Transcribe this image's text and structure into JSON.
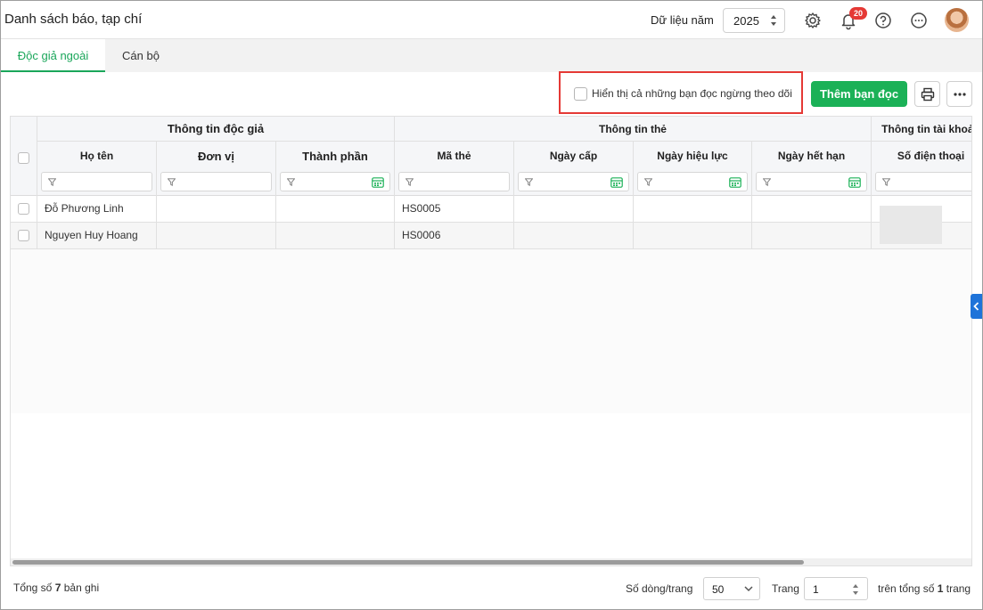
{
  "header": {
    "title": "Danh sách báo, tạp chí",
    "year_label": "Dữ liệu năm",
    "year_value": "2025",
    "notification_count": "20",
    "icons": [
      "gear-icon",
      "bell-icon",
      "help-icon",
      "more-icon"
    ]
  },
  "tabs": [
    {
      "label": "Độc giả ngoài",
      "active": true
    },
    {
      "label": "Cán bộ",
      "active": false
    }
  ],
  "toolbar": {
    "show_inactive_label": "Hiển thị cả những bạn đọc ngừng theo dõi",
    "add_label": "Thêm bạn đọc",
    "print_icon": "printer-icon",
    "more_icon": "ellipsis-icon"
  },
  "grid": {
    "groups": [
      "Thông tin độc giả",
      "Thông tin thẻ",
      "Thông tin tài khoản"
    ],
    "columns": [
      "Họ tên",
      "Đơn vị",
      "Thành phần",
      "Mã thẻ",
      "Ngày cấp",
      "Ngày hiệu lực",
      "Ngày hết hạn",
      "Số điện thoại"
    ],
    "rows": [
      {
        "name": "Đỗ Phương Linh",
        "unit": "",
        "type": "",
        "card": "HS0005",
        "issued": "",
        "valid_from": "",
        "expires": "",
        "phone": ""
      },
      {
        "name": "Nguyen Huy Hoang",
        "unit": "",
        "type": "",
        "card": "HS0006",
        "issued": "",
        "valid_from": "",
        "expires": "",
        "phone": ""
      }
    ]
  },
  "footer": {
    "total_prefix": "Tổng số",
    "total_count": "7",
    "total_suffix": "bản ghi",
    "rows_per_page_label": "Số dòng/trang",
    "rows_per_page_value": "50",
    "page_label": "Trang",
    "page_value": "1",
    "of_prefix": "trên tổng số",
    "of_count": "1",
    "of_suffix": "trang"
  },
  "colors": {
    "accent": "#1bb157",
    "highlight_border": "#e53935",
    "side_toggle": "#1e73d9"
  }
}
